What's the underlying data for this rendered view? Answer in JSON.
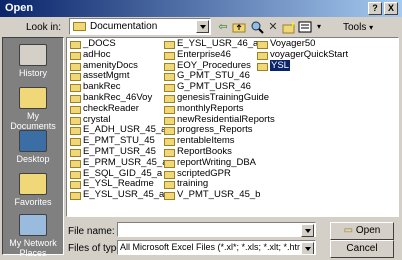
{
  "window": {
    "title": "Open",
    "help_label": "?",
    "close_label": "X"
  },
  "toolbar": {
    "look_in_label": "Look in:",
    "look_in_value": "Documentation",
    "tools_label": "Tools"
  },
  "places": [
    {
      "label": "History"
    },
    {
      "label": "My Documents"
    },
    {
      "label": "Desktop"
    },
    {
      "label": "Favorites"
    },
    {
      "label": "My Network Places"
    }
  ],
  "files": {
    "col1": [
      "_DOCS",
      "adHoc",
      "amenityDocs",
      "assetMgmt",
      "bankRec",
      "bankRec_46Voy",
      "checkReader",
      "crystal",
      "E_ADH_USR_45_a",
      "E_PMT_STU_45",
      "E_PMT_USR_45",
      "E_PRM_USR_45_a",
      "E_SQL_GID_45_a",
      "E_YSL_Readme",
      "E_YSL_USR_45_a"
    ],
    "col2": [
      "E_YSL_USR_46_a",
      "Enterprise46",
      "EOY_Procedures",
      "G_PMT_STU_46",
      "G_PMT_USR_46",
      "genesisTrainingGuide",
      "monthlyReports",
      "newResidentialReports",
      "progress_Reports",
      "rentableItems",
      "ReportBooks",
      "reportWriting_DBA",
      "scriptedGPR",
      "training",
      "V_PMT_USR_45_b"
    ],
    "col3": [
      "Voyager50",
      "voyagerQuickStart",
      "YSL"
    ],
    "selected": "YSL"
  },
  "bottom": {
    "file_name_label": "File name:",
    "file_name_value": "",
    "file_type_label": "Files of type:",
    "file_type_value": "All Microsoft Excel Files (*.xl*; *.xls; *.xlt; *.htm; *.html;",
    "open_label": "Open",
    "cancel_label": "Cancel"
  }
}
